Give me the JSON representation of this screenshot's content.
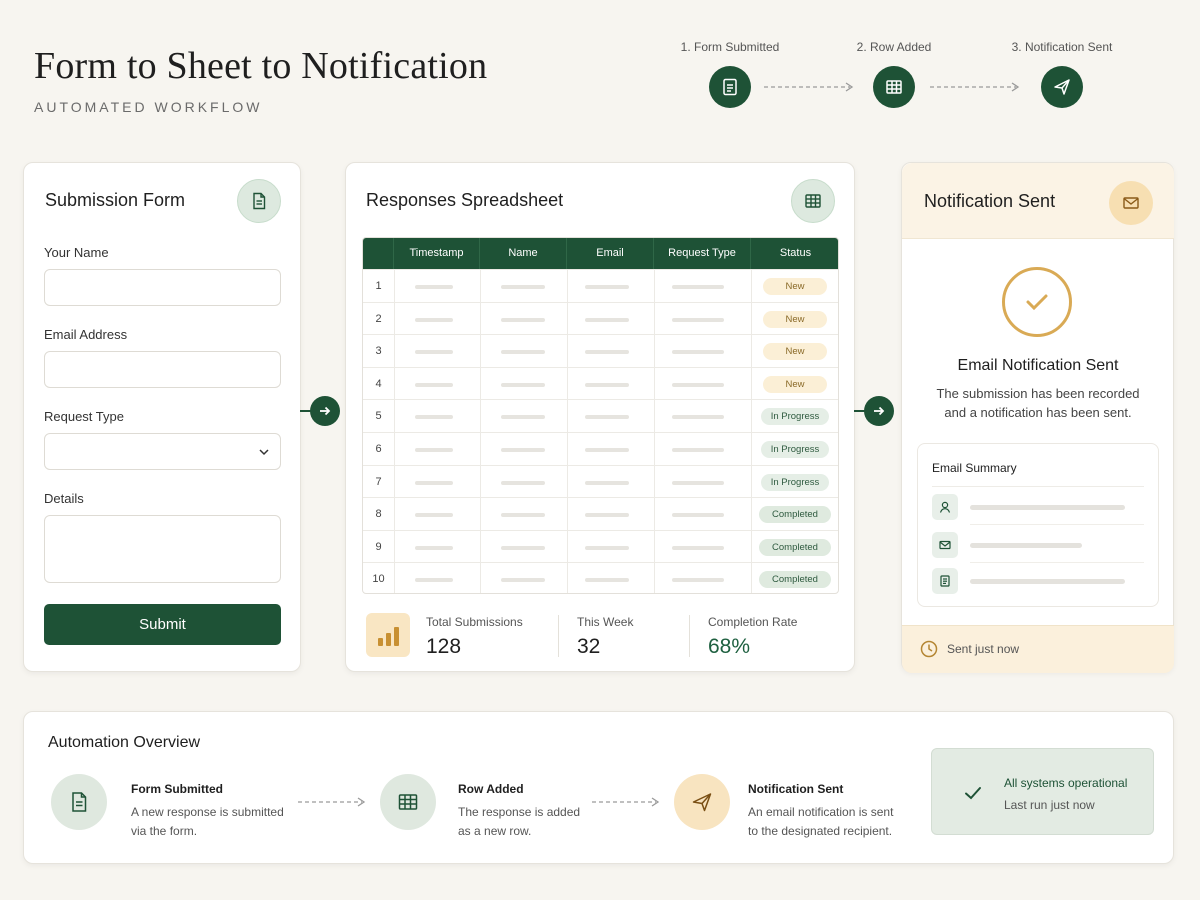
{
  "header": {
    "title": "Form to Sheet to Notification",
    "subtitle": "AUTOMATED WORKFLOW",
    "steps": [
      {
        "label": "1. Form Submitted",
        "icon": "document-icon"
      },
      {
        "label": "2. Row Added",
        "icon": "table-icon"
      },
      {
        "label": "3. Notification Sent",
        "icon": "send-icon"
      }
    ]
  },
  "form": {
    "title": "Submission Form",
    "fields": [
      {
        "label": "Your Name",
        "value": "",
        "placeholder": ""
      },
      {
        "label": "Email Address",
        "value": "",
        "placeholder": ""
      },
      {
        "label": "Request Type",
        "value": "",
        "placeholder": ""
      },
      {
        "label": "Details",
        "value": "",
        "placeholder": ""
      }
    ],
    "submit_label": "Submit"
  },
  "sheet": {
    "title": "Responses Spreadsheet",
    "columns": [
      "Timestamp",
      "Name",
      "Email",
      "Request Type",
      "Status"
    ],
    "rows": [
      {
        "num": "1",
        "status": "New"
      },
      {
        "num": "2",
        "status": "New"
      },
      {
        "num": "3",
        "status": "New"
      },
      {
        "num": "4",
        "status": "New"
      },
      {
        "num": "5",
        "status": "In Progress"
      },
      {
        "num": "6",
        "status": "In Progress"
      },
      {
        "num": "7",
        "status": "In Progress"
      },
      {
        "num": "8",
        "status": "Completed"
      },
      {
        "num": "9",
        "status": "Completed"
      },
      {
        "num": "10",
        "status": "Completed"
      }
    ],
    "stats": [
      {
        "label": "Total Submissions",
        "value": "128"
      },
      {
        "label": "This Week",
        "value": "32"
      },
      {
        "label": "Completion Rate",
        "value": "68%"
      }
    ]
  },
  "notification": {
    "title": "Notification Sent",
    "headline": "Email Notification Sent",
    "description_line1": "The submission has been recorded",
    "description_line2": "and a notification has been sent.",
    "summary_title": "Email Summary",
    "footer": "Sent just now"
  },
  "overview": {
    "title": "Automation Overview",
    "items": [
      {
        "title": "Form Submitted",
        "desc_line1": "A new response is submitted",
        "desc_line2": "via the form."
      },
      {
        "title": "Row Added",
        "desc_line1": "The response is added",
        "desc_line2": "as a new row."
      },
      {
        "title": "Notification Sent",
        "desc_line1": "An email notification is sent",
        "desc_line2": "to the designated recipient."
      }
    ],
    "status_title": "All systems operational",
    "status_sub": "Last run just now"
  },
  "colors": {
    "primary_green": "#1e5236",
    "amber": "#d9aa55",
    "background": "#f7f5f0"
  }
}
